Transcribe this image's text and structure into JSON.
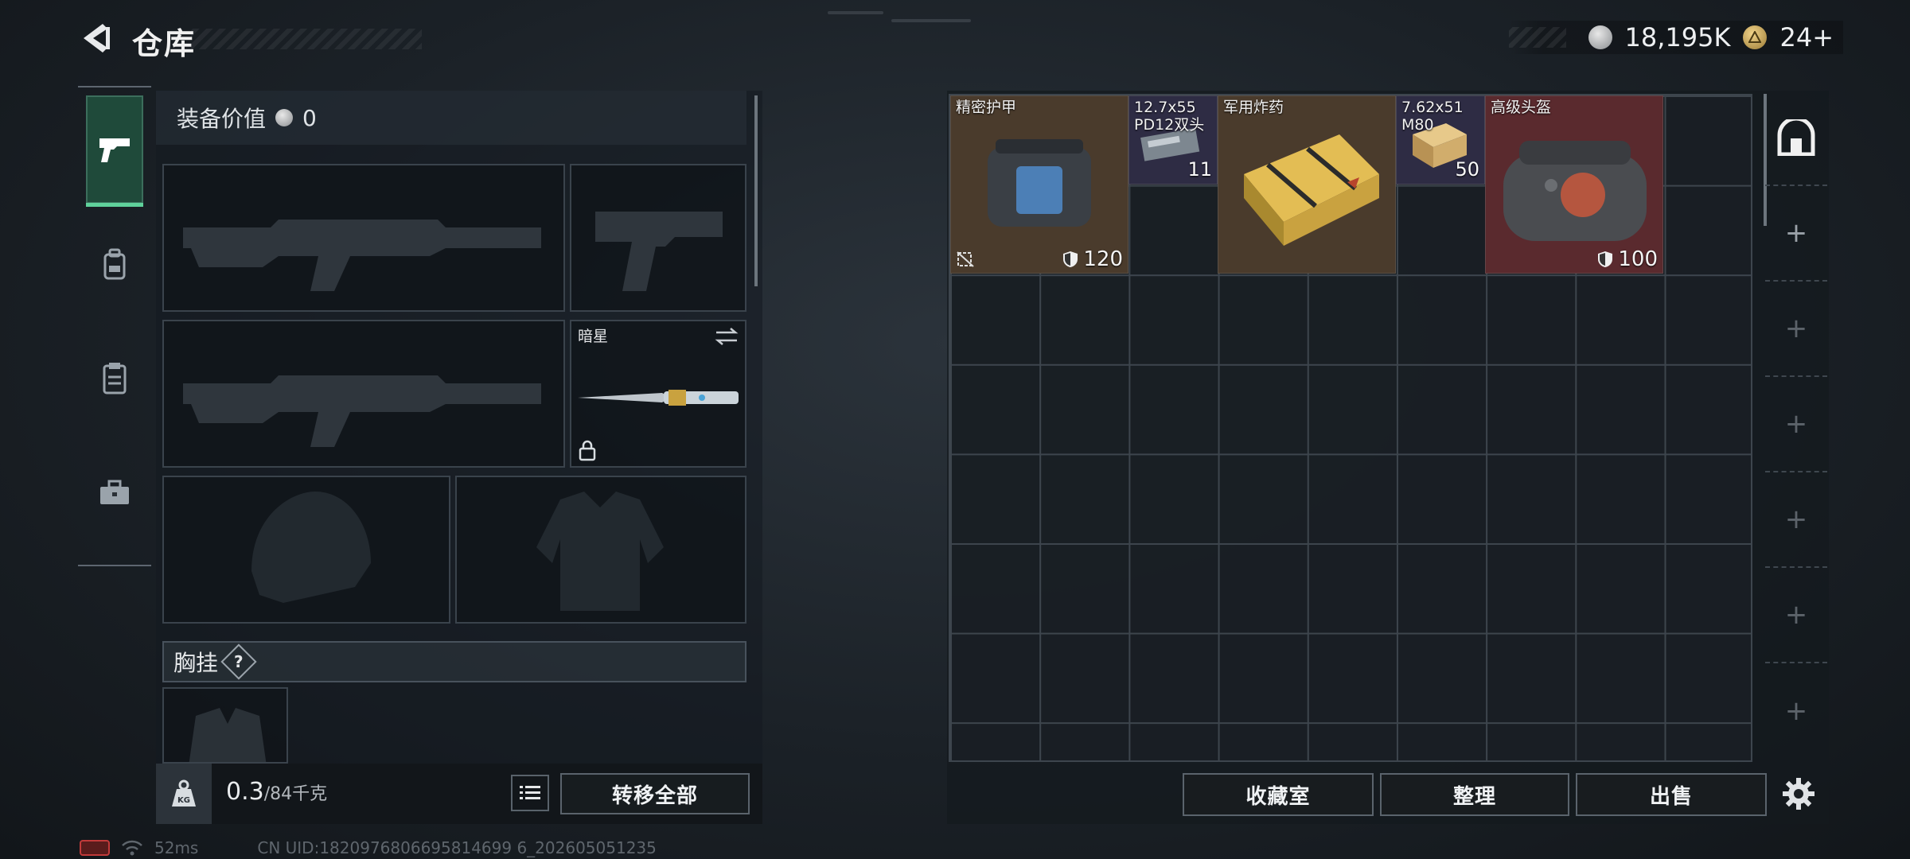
{
  "header": {
    "title": "仓库",
    "currency": [
      {
        "icon": "silver-coin-icon",
        "value": "18,195K"
      },
      {
        "icon": "gold-token-icon",
        "value": "24+"
      }
    ]
  },
  "tabs": [
    {
      "icon": "pistol-icon",
      "active": true
    },
    {
      "icon": "backpack-icon",
      "active": false
    },
    {
      "icon": "clipboard-icon",
      "active": false
    },
    {
      "icon": "briefcase-icon",
      "active": false
    }
  ],
  "loadout": {
    "equip_value_label": "装备价值",
    "equip_value": "0",
    "melee_name": "暗星",
    "chest_rig_label": "胸挂",
    "chest_rig_help": "?",
    "weight_current": "0.3",
    "weight_capacity": "/84千克",
    "weight_icon_text": "KG",
    "transfer_all_label": "转移全部"
  },
  "stash": {
    "items": [
      {
        "name": "精密护甲",
        "durability": "120",
        "bg": "#4a3b2c"
      },
      {
        "name": "12.7x55 PD12双头",
        "count": "11",
        "bg": "#2e2c44"
      },
      {
        "name": "军用炸药",
        "bg": "#4a3b2c"
      },
      {
        "name": "7.62x51 M80",
        "count": "50",
        "bg": "#2e2c44"
      },
      {
        "name": "高级头盔",
        "durability": "100",
        "bg": "#5a2a2e"
      }
    ],
    "buttons": {
      "collection": "收藏室",
      "organize": "整理",
      "sell": "出售"
    }
  },
  "status": {
    "ping": "52ms",
    "uid": "CN UID:1820976806695814699 6_202605051235"
  },
  "colors": {
    "accent": "#5fd19b",
    "armor_tier": "#4a3b2c",
    "ammo_tier": "#2e2c44",
    "helmet_tier": "#5a2a2e"
  }
}
